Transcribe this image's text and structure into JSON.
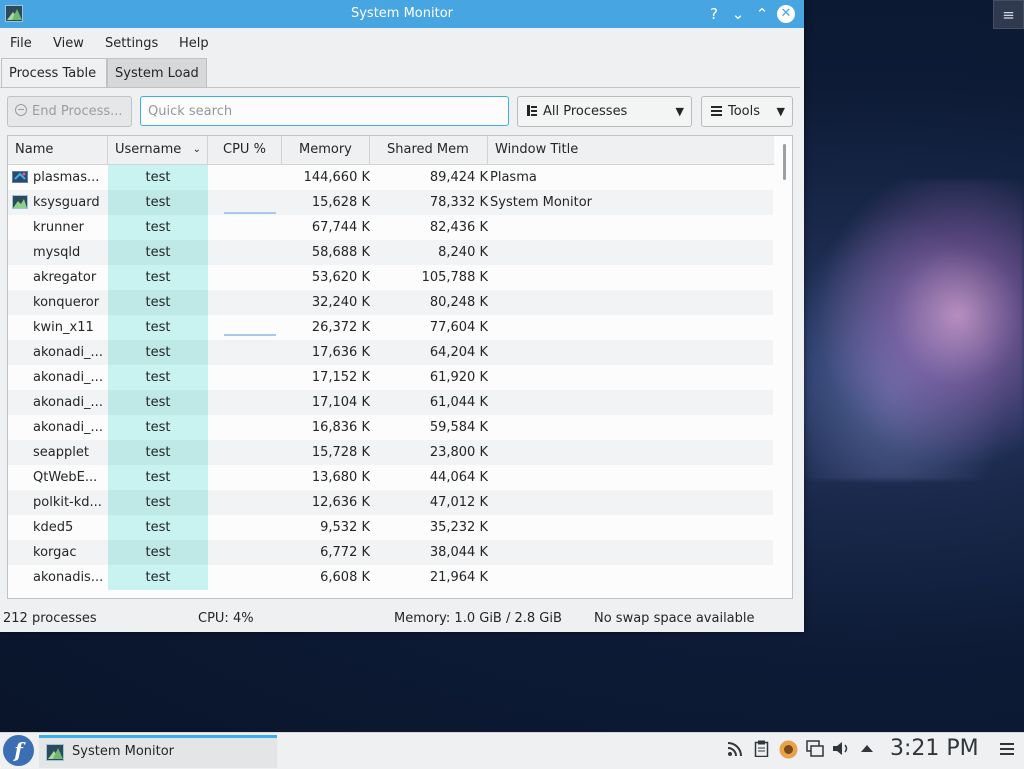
{
  "window": {
    "title": "System Monitor",
    "help_icon": "?",
    "min_icon": "⌄",
    "max_icon": "⌃",
    "close_icon": "✕"
  },
  "menu": [
    "File",
    "View",
    "Settings",
    "Help"
  ],
  "tabs": [
    "Process Table",
    "System Load"
  ],
  "toolbar": {
    "end_process_label": "End Process...",
    "search_placeholder": "Quick search",
    "filter_value": "All Processes",
    "tools_label": "Tools"
  },
  "columns": [
    "Name",
    "Username",
    "CPU %",
    "Memory",
    "Shared Mem",
    "Window Title"
  ],
  "rows": [
    {
      "name": "plasmas...",
      "icon": "plasma",
      "user": "test",
      "cpu": "",
      "mem": "144,660 K",
      "shm": "89,424 K",
      "win": "Plasma"
    },
    {
      "name": "ksysguard",
      "icon": "sysmon",
      "user": "test",
      "cpu": "",
      "mem": "15,628 K",
      "shm": "78,332 K",
      "win": "System Monitor"
    },
    {
      "name": "krunner",
      "user": "test",
      "cpu": "",
      "mem": "67,744 K",
      "shm": "82,436 K",
      "win": ""
    },
    {
      "name": "mysqld",
      "user": "test",
      "cpu": "",
      "mem": "58,688 K",
      "shm": "8,240 K",
      "win": ""
    },
    {
      "name": "akregator",
      "user": "test",
      "cpu": "",
      "mem": "53,620 K",
      "shm": "105,788 K",
      "win": ""
    },
    {
      "name": "konqueror",
      "user": "test",
      "cpu": "",
      "mem": "32,240 K",
      "shm": "80,248 K",
      "win": ""
    },
    {
      "name": "kwin_x11",
      "user": "test",
      "cpu": "",
      "mem": "26,372 K",
      "shm": "77,604 K",
      "win": ""
    },
    {
      "name": "akonadi_...",
      "user": "test",
      "cpu": "",
      "mem": "17,636 K",
      "shm": "64,204 K",
      "win": ""
    },
    {
      "name": "akonadi_...",
      "user": "test",
      "cpu": "",
      "mem": "17,152 K",
      "shm": "61,920 K",
      "win": ""
    },
    {
      "name": "akonadi_...",
      "user": "test",
      "cpu": "",
      "mem": "17,104 K",
      "shm": "61,044 K",
      "win": ""
    },
    {
      "name": "akonadi_...",
      "user": "test",
      "cpu": "",
      "mem": "16,836 K",
      "shm": "59,584 K",
      "win": ""
    },
    {
      "name": "seapplet",
      "user": "test",
      "cpu": "",
      "mem": "15,728 K",
      "shm": "23,800 K",
      "win": ""
    },
    {
      "name": "QtWebE...",
      "user": "test",
      "cpu": "",
      "mem": "13,680 K",
      "shm": "44,064 K",
      "win": ""
    },
    {
      "name": "polkit-kd...",
      "user": "test",
      "cpu": "",
      "mem": "12,636 K",
      "shm": "47,012 K",
      "win": ""
    },
    {
      "name": "kded5",
      "user": "test",
      "cpu": "",
      "mem": "9,532 K",
      "shm": "35,232 K",
      "win": ""
    },
    {
      "name": "korgac",
      "user": "test",
      "cpu": "",
      "mem": "6,772 K",
      "shm": "38,044 K",
      "win": ""
    },
    {
      "name": "akonadis...",
      "user": "test",
      "cpu": "",
      "mem": "6,608 K",
      "shm": "21,964 K",
      "win": ""
    }
  ],
  "status": {
    "processes": "212 processes",
    "cpu": "CPU: 4%",
    "memory": "Memory: 1.0 GiB / 2.8 GiB",
    "swap": "No swap space available"
  },
  "taskbar": {
    "task_label": "System Monitor",
    "clock": "3:21 PM",
    "launcher_glyph": "f"
  },
  "colors": {
    "accent": "#3daee9",
    "titlebar": "#47a5e2",
    "user_cell": "#c9f3f1"
  }
}
